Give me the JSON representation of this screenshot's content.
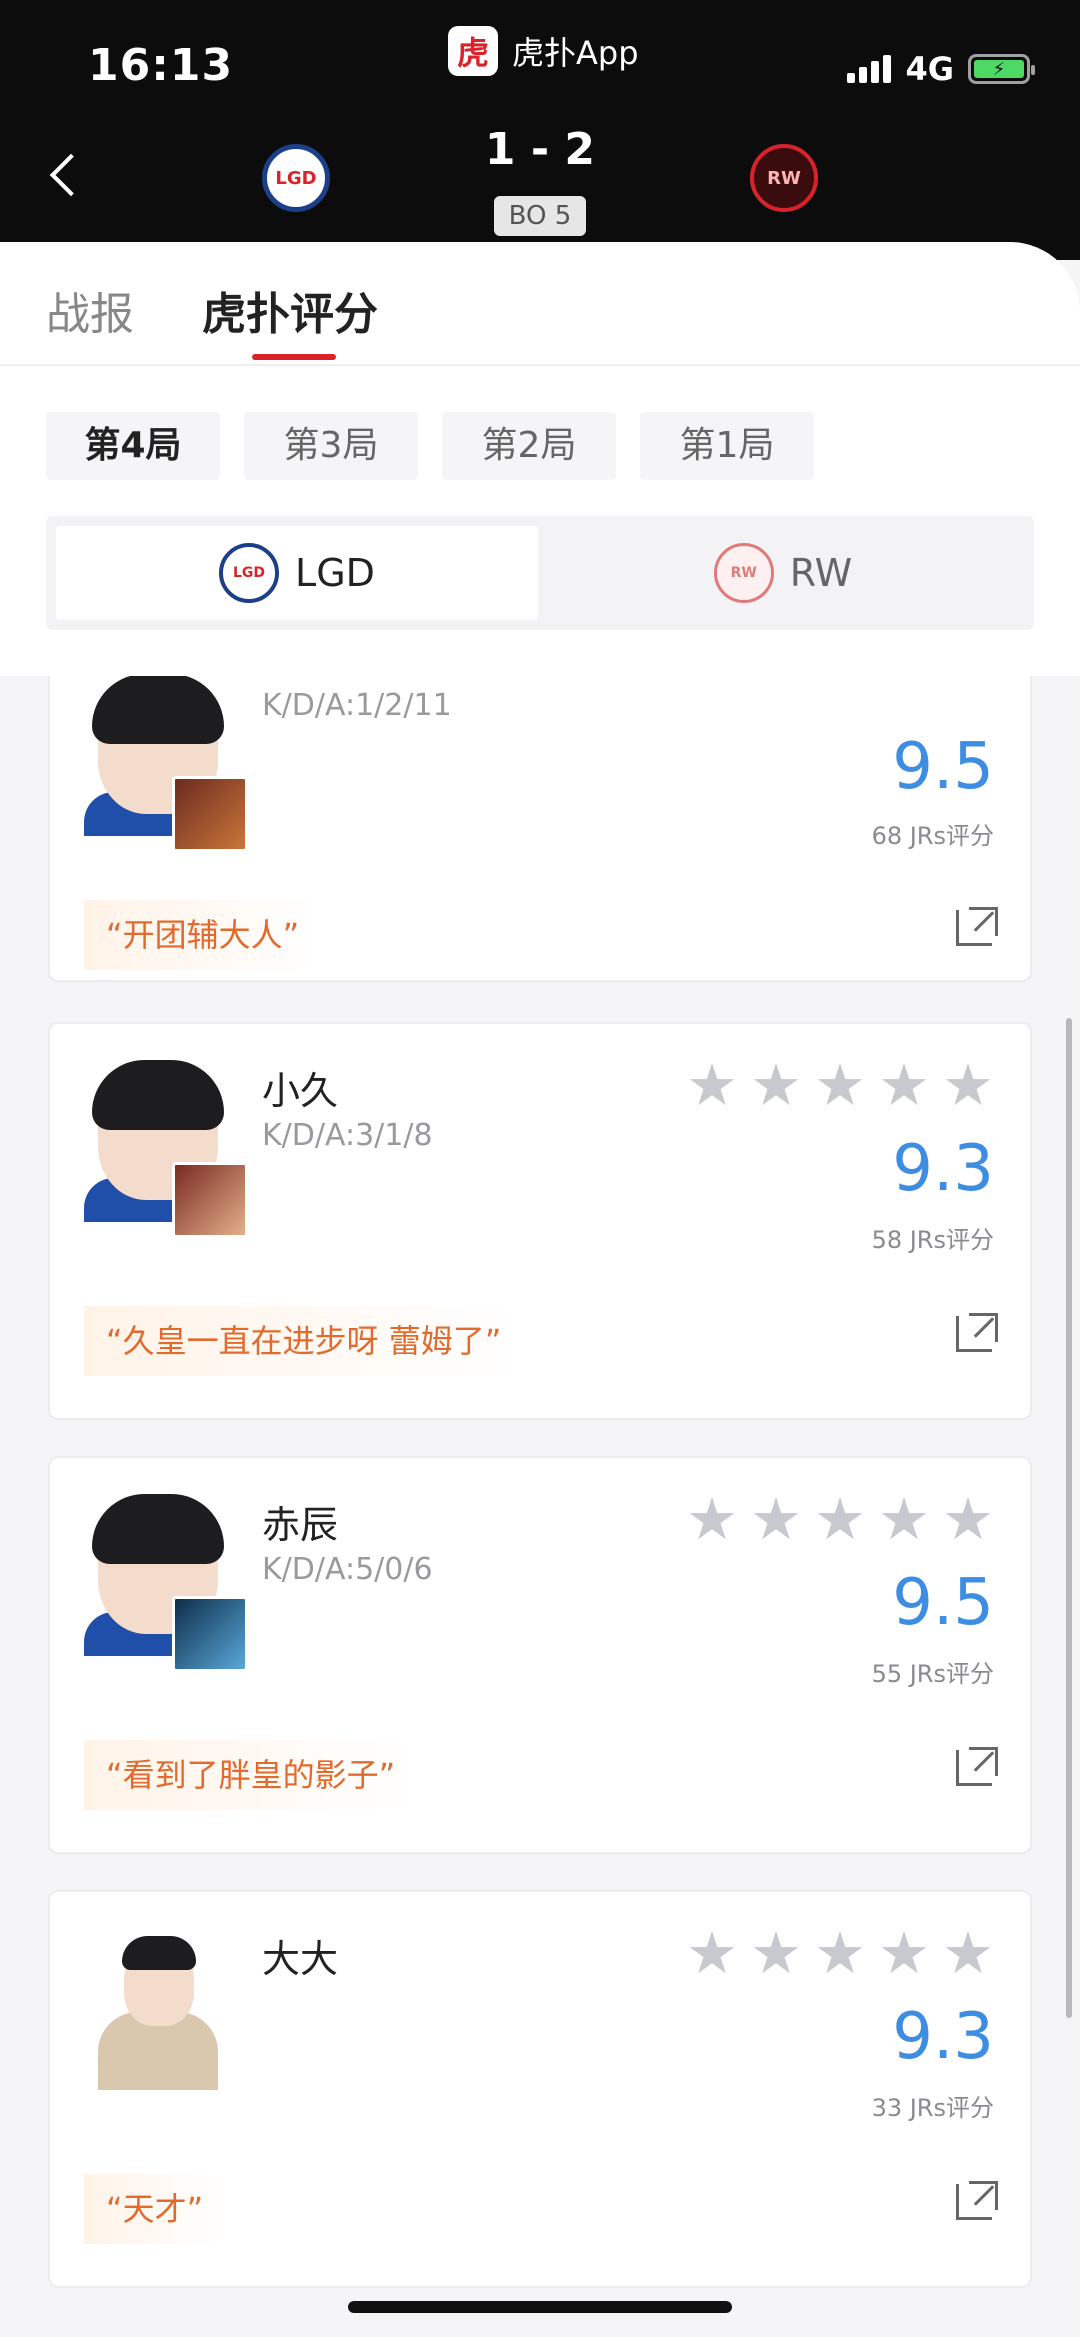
{
  "status_bar": {
    "time": "16:13",
    "app_name": "虎扑App",
    "app_logo_text": "虎",
    "network": "4G"
  },
  "match": {
    "score": "1 - 2",
    "format": "BO 5",
    "home_team": "LGD",
    "away_team": "RW"
  },
  "tabs": [
    {
      "label": "战报",
      "active": false
    },
    {
      "label": "虎扑评分",
      "active": true
    }
  ],
  "games": [
    {
      "label": "第4局",
      "active": true
    },
    {
      "label": "第3局",
      "active": false
    },
    {
      "label": "第2局",
      "active": false
    },
    {
      "label": "第1局",
      "active": false
    }
  ],
  "team_switch": [
    {
      "label": "LGD",
      "active": true
    },
    {
      "label": "RW",
      "active": false
    }
  ],
  "players": [
    {
      "name": "",
      "kda": "K/D/A:1/2/11",
      "score": "9.5",
      "votes": "68 JRs评分",
      "comment": "“开团辅大人”"
    },
    {
      "name": "小久",
      "kda": "K/D/A:3/1/8",
      "score": "9.3",
      "votes": "58 JRs评分",
      "comment": "“久皇一直在进步呀 蕾姆了”"
    },
    {
      "name": "赤辰",
      "kda": "K/D/A:5/0/6",
      "score": "9.5",
      "votes": "55 JRs评分",
      "comment": "“看到了胖皇的影子”"
    },
    {
      "name": "大大",
      "kda": "",
      "score": "9.3",
      "votes": "33 JRs评分",
      "comment": "“天才”"
    }
  ],
  "colors": {
    "accent_red": "#d8232a",
    "score_blue": "#3d8ee2",
    "comment_orange": "#e26a2c"
  }
}
